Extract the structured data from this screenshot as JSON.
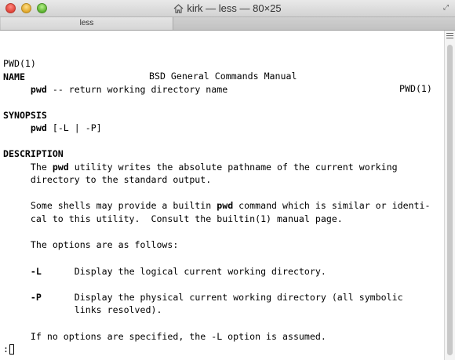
{
  "window": {
    "title": "kirk — less — 80×25",
    "tab_label": "less",
    "icons": [
      "close-button",
      "minimize-button",
      "zoom-button",
      "home-icon",
      "fullscreen-icon",
      "scroll-menu-icon"
    ]
  },
  "man": {
    "header_left": "PWD(1)",
    "header_center": "BSD General Commands Manual",
    "header_right": "PWD(1)",
    "name_heading": "NAME",
    "name_cmd": "pwd",
    "name_desc": " -- return working directory name",
    "synopsis_heading": "SYNOPSIS",
    "synopsis_cmd": "pwd",
    "synopsis_args": " [-L | -P]",
    "description_heading": "DESCRIPTION",
    "desc1_a": "The ",
    "desc1_cmd": "pwd",
    "desc1_b": " utility writes the absolute pathname of the current working",
    "desc2": "directory to the standard output.",
    "desc3_a": "Some shells may provide a builtin ",
    "desc3_cmd": "pwd",
    "desc3_b": " command which is similar or identi-",
    "desc4": "cal to this utility.  Consult the builtin(1) manual page.",
    "desc5": "The options are as follows:",
    "opt_L_flag": "-L",
    "opt_L_desc": "Display the logical current working directory.",
    "opt_P_flag": "-P",
    "opt_P_desc1": "Display the physical current working directory (all symbolic",
    "opt_P_desc2": "links resolved).",
    "final": "If no options are specified, the -L option is assumed.",
    "prompt": ":"
  }
}
